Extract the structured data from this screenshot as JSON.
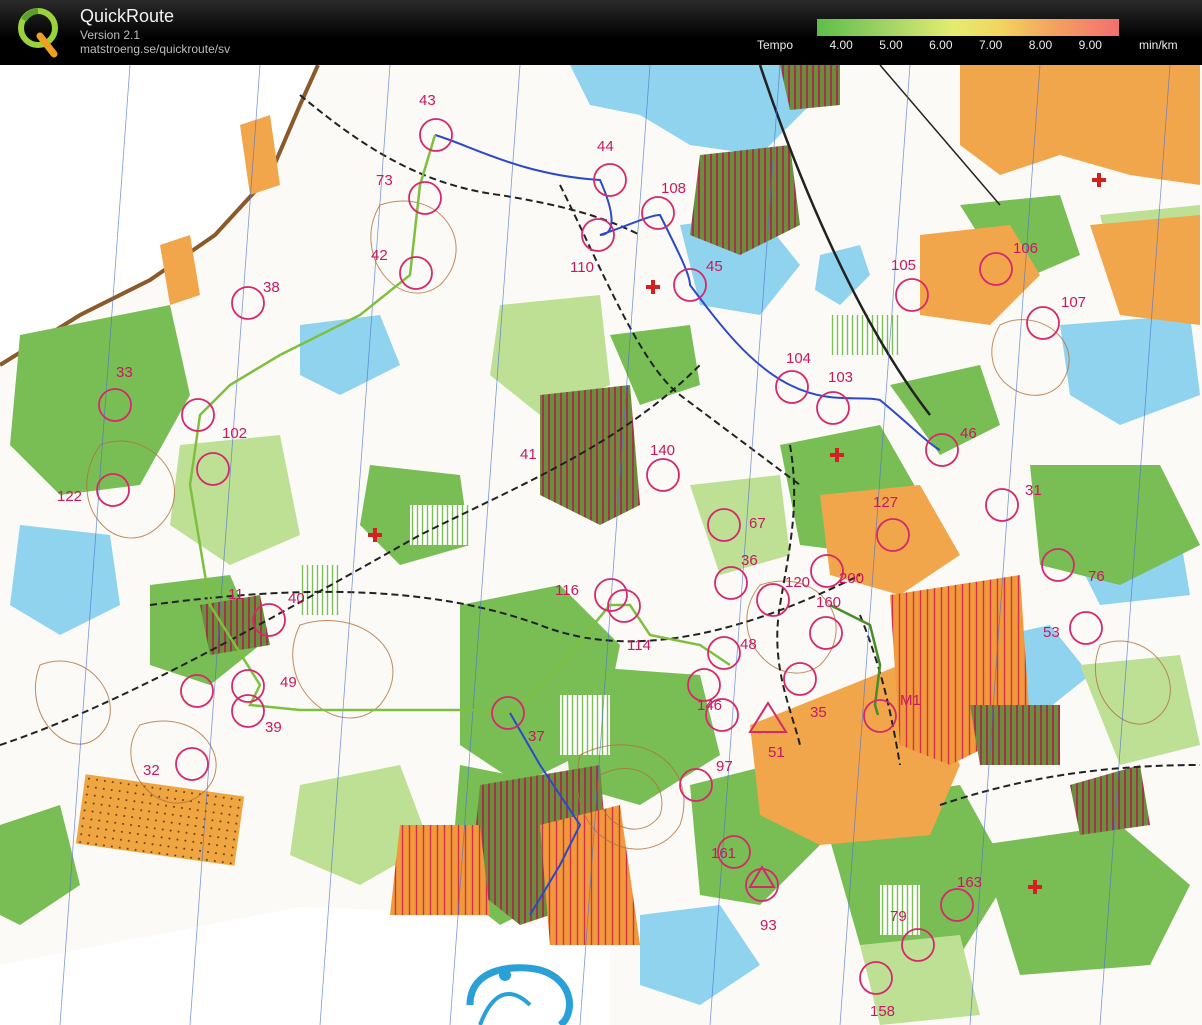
{
  "header": {
    "app_name": "QuickRoute",
    "version": "Version 2.1",
    "url": "matstroeng.se/quickroute/sv",
    "logo_letter": "Q"
  },
  "legend": {
    "title": "Tempo",
    "ticks": [
      "4.00",
      "5.00",
      "6.00",
      "7.00",
      "8.00",
      "9.00"
    ],
    "unit": "min/km"
  },
  "map": {
    "colors": {
      "paper": "#ffffff",
      "open": "#f2a84a",
      "forest_green": "#6fb84b",
      "light_green": "#b8dc8f",
      "water": "#7ccdea",
      "control": "#d42a6b",
      "route": "#2d49c8"
    },
    "controls": [
      {
        "label": "43"
      },
      {
        "label": "44"
      },
      {
        "label": "73"
      },
      {
        "label": "108"
      },
      {
        "label": "42"
      },
      {
        "label": "110"
      },
      {
        "label": "45"
      },
      {
        "label": "105"
      },
      {
        "label": "106"
      },
      {
        "label": "107"
      },
      {
        "label": "38"
      },
      {
        "label": "33"
      },
      {
        "label": "104"
      },
      {
        "label": "103"
      },
      {
        "label": "102"
      },
      {
        "label": "46"
      },
      {
        "label": "140"
      },
      {
        "label": "122"
      },
      {
        "label": "127"
      },
      {
        "label": "31"
      },
      {
        "label": "67"
      },
      {
        "label": "36"
      },
      {
        "label": "120"
      },
      {
        "label": "200"
      },
      {
        "label": "76"
      },
      {
        "label": "40"
      },
      {
        "label": "116"
      },
      {
        "label": "160"
      },
      {
        "label": "53"
      },
      {
        "label": "114"
      },
      {
        "label": "48"
      },
      {
        "label": "49"
      },
      {
        "label": "146"
      },
      {
        "label": "35"
      },
      {
        "label": "37"
      },
      {
        "label": "39"
      },
      {
        "label": "51"
      },
      {
        "label": "97"
      },
      {
        "label": "32"
      },
      {
        "label": "161"
      },
      {
        "label": "163"
      },
      {
        "label": "93"
      },
      {
        "label": "79"
      },
      {
        "label": "158"
      },
      {
        "label": "M1"
      },
      {
        "label": "11"
      },
      {
        "label": "41"
      }
    ]
  }
}
